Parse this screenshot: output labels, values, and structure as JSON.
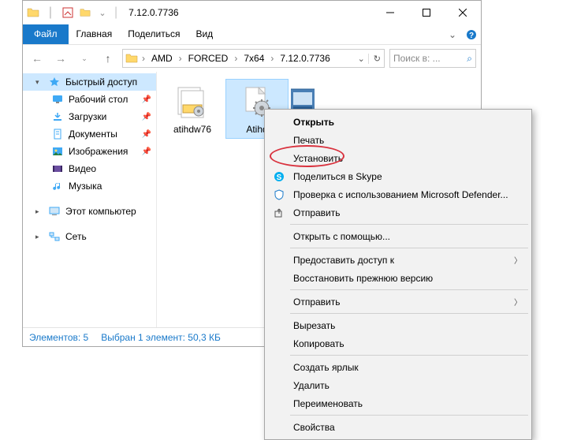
{
  "title": "7.12.0.7736",
  "ribbon": {
    "file": "Файл",
    "tabs": [
      "Главная",
      "Поделиться",
      "Вид"
    ]
  },
  "breadcrumb": [
    "AMD",
    "FORCED",
    "7x64",
    "7.12.0.7736"
  ],
  "search_placeholder": "Поиск в: ...",
  "sidebar": {
    "quick_access": "Быстрый доступ",
    "items": [
      {
        "label": "Рабочий стол",
        "pinned": true
      },
      {
        "label": "Загрузки",
        "pinned": true
      },
      {
        "label": "Документы",
        "pinned": true
      },
      {
        "label": "Изображения",
        "pinned": true
      },
      {
        "label": "Видео",
        "pinned": false
      },
      {
        "label": "Музыка",
        "pinned": false
      }
    ],
    "this_pc": "Этот компьютер",
    "network": "Сеть"
  },
  "files": [
    {
      "label": "atihdw76",
      "selected": false
    },
    {
      "label": "Atihd",
      "selected": true
    },
    {
      "label": "",
      "selected": false
    }
  ],
  "status": {
    "count": "Элементов: 5",
    "selection": "Выбран 1 элемент: 50,3 КБ"
  },
  "context_menu": [
    {
      "label": "Открыть",
      "bold": true
    },
    {
      "label": "Печать"
    },
    {
      "label": "Установить",
      "highlighted": true
    },
    {
      "label": "Поделиться в Skype",
      "icon": "skype"
    },
    {
      "label": "Проверка с использованием Microsoft Defender...",
      "icon": "defender"
    },
    {
      "label": "Отправить",
      "icon": "share"
    },
    {
      "sep": true
    },
    {
      "label": "Открыть с помощью..."
    },
    {
      "sep": true
    },
    {
      "label": "Предоставить доступ к",
      "submenu": true
    },
    {
      "label": "Восстановить прежнюю версию"
    },
    {
      "sep": true
    },
    {
      "label": "Отправить",
      "submenu": true
    },
    {
      "sep": true
    },
    {
      "label": "Вырезать"
    },
    {
      "label": "Копировать"
    },
    {
      "sep": true
    },
    {
      "label": "Создать ярлык"
    },
    {
      "label": "Удалить"
    },
    {
      "label": "Переименовать"
    },
    {
      "sep": true
    },
    {
      "label": "Свойства"
    }
  ]
}
